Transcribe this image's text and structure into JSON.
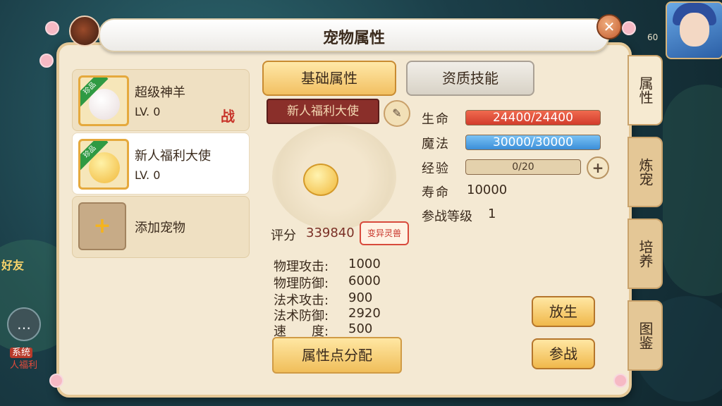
{
  "window": {
    "title": "宠物属性"
  },
  "hud": {
    "top_level": "60",
    "friend_label": "好友",
    "chat_icon": "speech-bubble-icon",
    "sys_tag": "系统",
    "sys_msg": "人福利"
  },
  "pets": [
    {
      "name": "超级神羊",
      "level": "LV. 0",
      "badge": "珍品",
      "battle_mark": "战",
      "color": "#f6f1ee"
    },
    {
      "name": "新人福利大使",
      "level": "LV. 0",
      "badge": "珍品",
      "color": "#f6c54a"
    }
  ],
  "add_pet": {
    "label": "添加宠物",
    "icon": "plus-icon"
  },
  "tabs": [
    {
      "label": "基础属性",
      "active": true
    },
    {
      "label": "资质技能",
      "active": false
    }
  ],
  "detail": {
    "name": "新人福利大使",
    "edit_icon": "pencil-icon",
    "score_label": "评分",
    "score": "339840",
    "mutation_badge": "变异灵兽",
    "stats": [
      {
        "label": "物理攻击:",
        "value": "1000"
      },
      {
        "label": "物理防御:",
        "value": "6000"
      },
      {
        "label": "法术攻击:",
        "value": "900"
      },
      {
        "label": "法术防御:",
        "value": "2920"
      },
      {
        "label": "速　　度:",
        "value": "500"
      }
    ],
    "alloc_button": "属性点分配"
  },
  "right_stats": {
    "hp_label": "生命",
    "hp_value": "24400/24400",
    "mp_label": "魔法",
    "mp_value": "30000/30000",
    "exp_label": "经验",
    "exp_value": "0/20",
    "lifespan_label": "寿命",
    "lifespan_value": "10000",
    "battle_level_label": "参战等级",
    "battle_level_value": "1"
  },
  "actions": {
    "release": "放生",
    "battle": "参战"
  },
  "side_tabs": [
    {
      "label": "属性",
      "active": true
    },
    {
      "label": "炼宠",
      "active": false
    },
    {
      "label": "培养",
      "active": false
    },
    {
      "label": "图鉴",
      "active": false
    }
  ]
}
